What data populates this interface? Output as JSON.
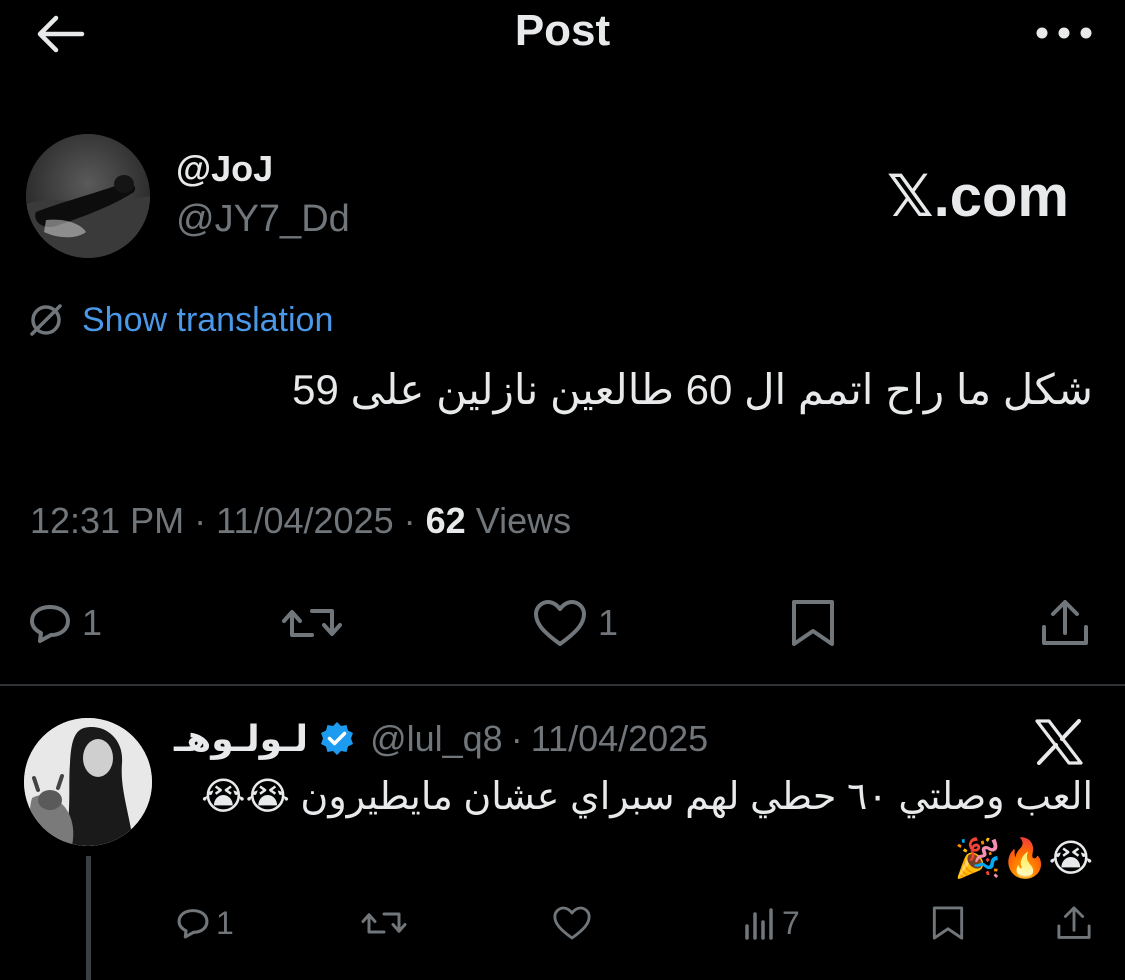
{
  "header": {
    "title": "Post"
  },
  "post": {
    "author_name": "@JoJ",
    "author_handle": "@JY7_Dd",
    "watermark": "𝕏.com",
    "translate_label": "Show translation",
    "text": "شكل ما راح اتمم ال 60 طالعين نازلين على 59",
    "time": "12:31 PM",
    "date": "11/04/2025",
    "views_count": "62",
    "views_label": "Views",
    "replies": "1",
    "likes": "1"
  },
  "reply": {
    "name": "لـولـوهـ",
    "handle": "@lul_q8",
    "separator": "·",
    "date": "11/04/2025",
    "text": "العب وصلتي ٦٠ حطي لهم سبراي عشان مايطيرون 😭😭 😭🔥🎉",
    "replies": "1",
    "views": "7"
  },
  "colors": {
    "background": "#000000",
    "text": "#e7e9ea",
    "muted": "#71767b",
    "link": "#4a99e9",
    "verified": "#1d9bf0"
  },
  "icons": [
    "back-arrow-icon",
    "more-icon",
    "translate-icon",
    "reply-icon",
    "retweet-icon",
    "like-icon",
    "bookmark-icon",
    "share-icon",
    "verified-icon",
    "x-logo-icon",
    "views-icon"
  ]
}
